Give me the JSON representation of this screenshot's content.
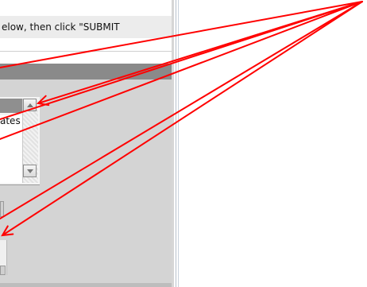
{
  "form": {
    "instruction_text": "elow, then click \"SUBMIT",
    "list_item_text": "ates"
  },
  "annotations": {
    "arrow_color": "#ff0000"
  }
}
